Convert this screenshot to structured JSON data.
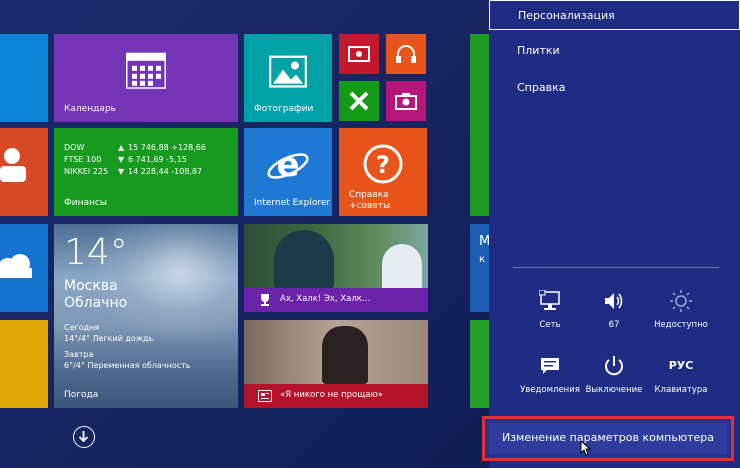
{
  "tiles": {
    "calendar": "Календарь",
    "photos": "Фотографии",
    "finance": "Финансы",
    "finance_rows": [
      {
        "name": "DOW",
        "arrow": "▲",
        "value": "15 746,88 +128,66"
      },
      {
        "name": "FTSE 100",
        "arrow": "▼",
        "value": "6 741,69 -5,15"
      },
      {
        "name": "NIKKEI 225",
        "arrow": "▼",
        "value": "14 228,44 -108,87"
      }
    ],
    "ie": "Internet Explorer",
    "help_line1": "Справка",
    "help_line2": "+советы",
    "weather": {
      "temp": "14°",
      "city": "Москва",
      "cond": "Облачно",
      "today_label": "Сегодня",
      "today": "14°/4° Легкий дождь",
      "tomorrow_label": "Завтра",
      "tomorrow": "6°/4° Переменная облачность",
      "app": "Погода"
    },
    "sport": "Ах, Халк! Эх, Халк...",
    "news": "«Я никого не прощаю»",
    "partial_m": "М",
    "partial_k": "к"
  },
  "charms": {
    "personalization": "Персонализация",
    "tiles": "Плитки",
    "help": "Справка",
    "quick": [
      {
        "icon": "network-icon",
        "label": "Сеть"
      },
      {
        "icon": "volume-icon",
        "label": "67"
      },
      {
        "icon": "brightness-icon",
        "label": "Недоступно"
      },
      {
        "icon": "notifications-icon",
        "label": "Уведомления"
      },
      {
        "icon": "power-icon",
        "label": "Выключение"
      },
      {
        "icon": "keyboard-icon",
        "label": "Клавиатура",
        "glyph": "РУС"
      }
    ],
    "change_settings": "Изменение параметров компьютера"
  },
  "colors": {
    "background": "#13205a",
    "charms_bg": "#1e2c83",
    "highlight": "#e0313a"
  }
}
